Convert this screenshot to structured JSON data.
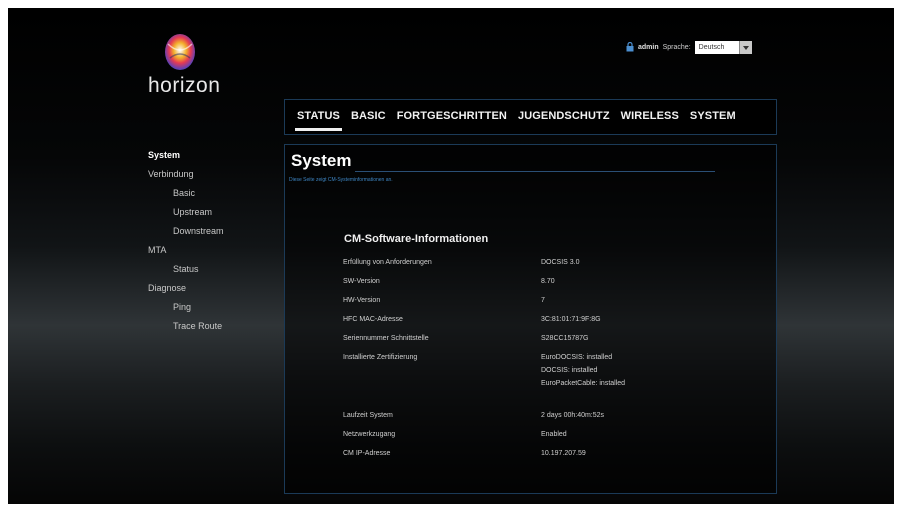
{
  "brand": {
    "logo_text": "horizon",
    "icon": "horizon-logo-icon"
  },
  "top_right": {
    "lock_icon": "lock-icon",
    "user": "admin",
    "language_label": "Sprache:",
    "language_value": "Deutsch",
    "dropdown_icon": "chevron-down-icon"
  },
  "top_nav": {
    "items": [
      {
        "label": "STATUS"
      },
      {
        "label": "BASIC"
      },
      {
        "label": "FORTGESCHRITTEN"
      },
      {
        "label": "JUGENDSCHUTZ"
      },
      {
        "label": "WIRELESS"
      },
      {
        "label": "SYSTEM"
      }
    ],
    "active": "STATUS"
  },
  "side_nav": {
    "items": [
      {
        "label": "System"
      },
      {
        "label": "Verbindung"
      },
      {
        "label": "Basic"
      },
      {
        "label": "Upstream"
      },
      {
        "label": "Downstream"
      },
      {
        "label": "MTA"
      },
      {
        "label": "Status"
      },
      {
        "label": "Diagnose"
      },
      {
        "label": "Ping"
      },
      {
        "label": "Trace Route"
      }
    ]
  },
  "main": {
    "title": "System",
    "description": "Diese Seite zeigt CM-Systeminformationen an.",
    "section_title": "CM-Software-Informationen",
    "rows": [
      {
        "key": "Erfüllung von Anforderungen",
        "value": "DOCSIS 3.0"
      },
      {
        "key": "SW-Version",
        "value": "8.70"
      },
      {
        "key": "HW-Version",
        "value": "7"
      },
      {
        "key": "HFC MAC-Adresse",
        "value": "3C:81:01:71:9F:8G"
      },
      {
        "key": "Seriennummer Schnittstelle",
        "value": "S28CC15787G"
      },
      {
        "key": "Installierte Zertifizierung",
        "values": [
          "EuroDOCSIS: installed",
          "DOCSIS: installed",
          "EuroPacketCable: installed"
        ]
      },
      {
        "key": "Laufzeit System",
        "value": "2 days 00h:40m:52s"
      },
      {
        "key": "Netzwerkzugang",
        "value": "Enabled"
      },
      {
        "key": "CM IP-Adresse",
        "value": "10.197.207.59"
      }
    ]
  },
  "colors": {
    "accent_blue": "#3f86c4",
    "border_blue": "#1b3a57",
    "background": "#000000"
  }
}
